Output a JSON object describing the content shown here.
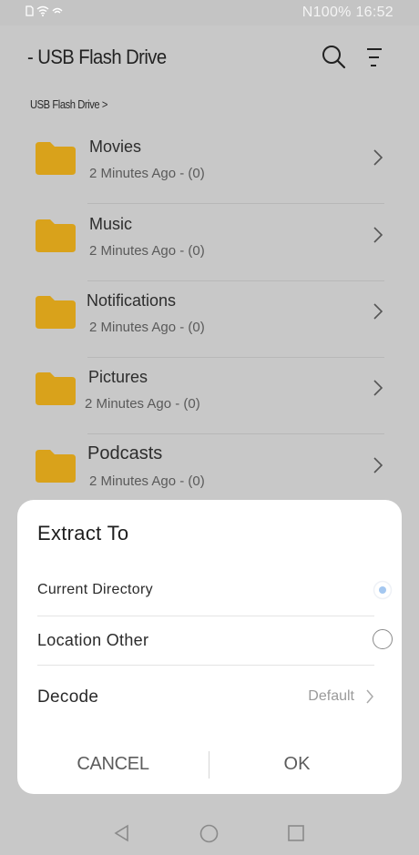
{
  "status_bar": {
    "left_icons": [
      "sim-icon",
      "wifi-icon",
      "signal-icon"
    ],
    "right_text": "N100% 16:52"
  },
  "app_bar": {
    "title": "- USB Flash Drive",
    "icons": [
      "search-icon",
      "sort-icon"
    ]
  },
  "breadcrumb": "USB Flash Drive >",
  "folders": [
    {
      "name": "Movies",
      "meta": "2 Minutes Ago - (0)"
    },
    {
      "name": "Music",
      "meta": "2 Minutes Ago - (0)"
    },
    {
      "name": "Notifications",
      "meta": "2 Minutes Ago - (0)"
    },
    {
      "name": "Pictures",
      "meta": "2 Minutes Ago - (0)"
    },
    {
      "name": "Podcasts",
      "meta": "2 Minutes Ago - (0)"
    }
  ],
  "dialog": {
    "title": "Extract To",
    "options": [
      {
        "label": "Current Directory",
        "selected": true
      },
      {
        "label": "Location Other",
        "selected": false
      }
    ],
    "decode": {
      "label": "Decode",
      "value": "Default"
    },
    "cancel_label": "CANCEL",
    "ok_label": "OK"
  },
  "nav_bar": {
    "icons": [
      "back-icon",
      "home-icon",
      "recent-apps-icon"
    ]
  },
  "colors": {
    "folder": "#d9a21b",
    "overlay": "#c8c8c8",
    "dialog_bg": "#ffffff",
    "accent": "#4a90e2"
  }
}
